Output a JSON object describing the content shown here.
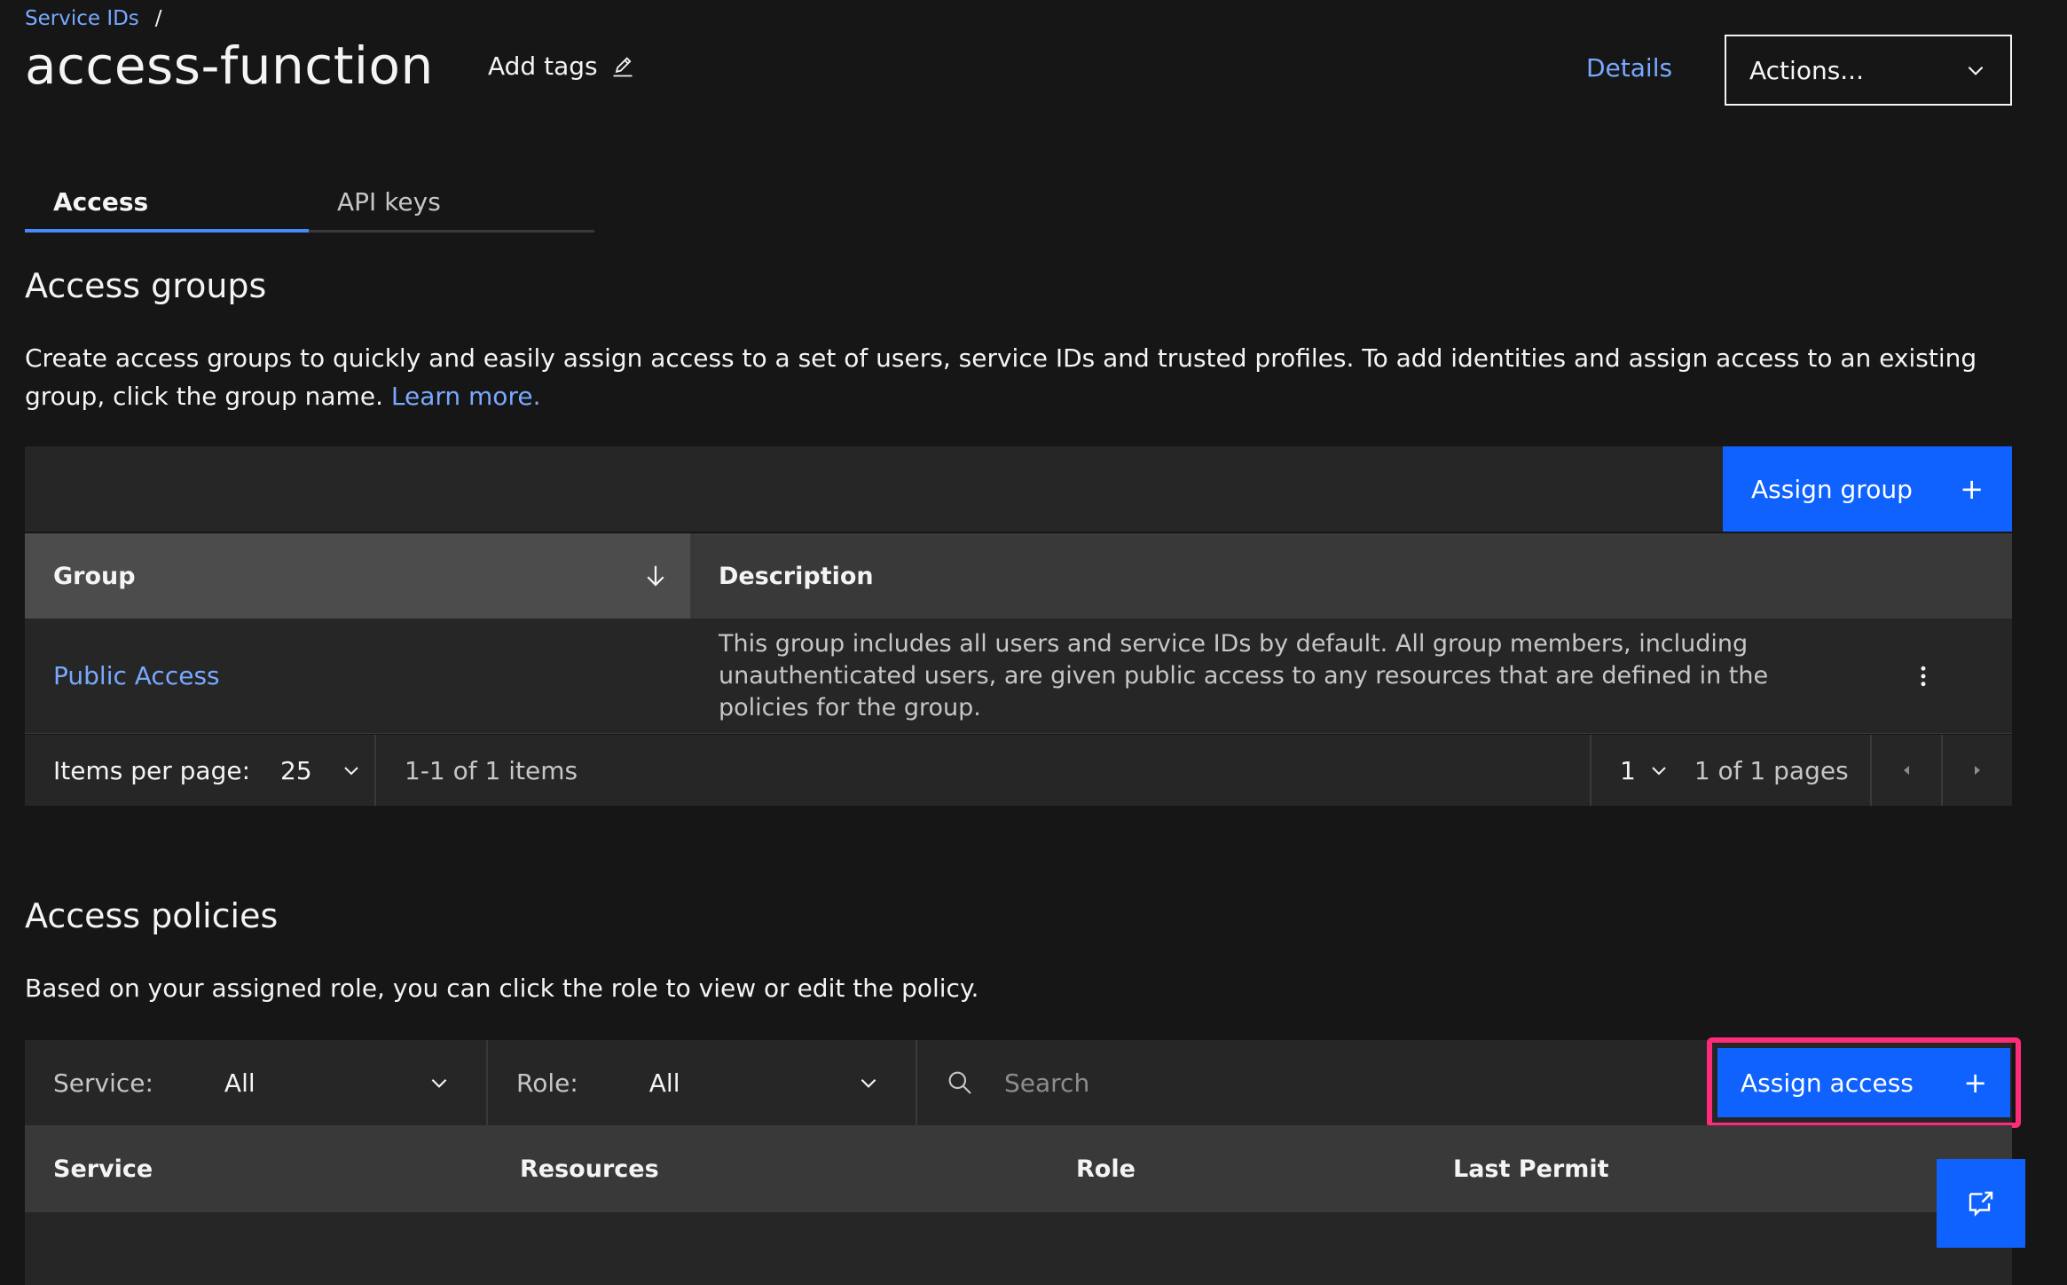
{
  "breadcrumb": {
    "items": [
      "Service IDs"
    ],
    "separator": "/"
  },
  "header": {
    "title": "access-function",
    "add_tags_label": "Add tags",
    "details_label": "Details",
    "actions_label": "Actions..."
  },
  "tabs": [
    {
      "label": "Access",
      "active": true
    },
    {
      "label": "API keys",
      "active": false
    }
  ],
  "access_groups": {
    "title": "Access groups",
    "description_text": "Create access groups to quickly and easily assign access to a set of users, service IDs and trusted profiles. To add identities and assign access to an existing group, click the group name.",
    "learn_more": "Learn more.",
    "assign_button": "Assign group",
    "columns": {
      "group": "Group",
      "description": "Description"
    },
    "rows": [
      {
        "group": "Public Access",
        "description": "This group includes all users and service IDs by default. All group members, including unauthenticated users, are given public access to any resources that are defined in the policies for the group."
      }
    ],
    "pagination": {
      "items_per_page_label": "Items per page:",
      "items_per_page_value": "25",
      "range_text": "1-1 of 1 items",
      "page_value": "1",
      "pages_text": "1 of 1 pages"
    }
  },
  "access_policies": {
    "title": "Access policies",
    "description_text": "Based on your assigned role, you can click the role to view or edit the policy.",
    "filters": {
      "service_label": "Service:",
      "service_value": "All",
      "role_label": "Role:",
      "role_value": "All",
      "search_placeholder": "Search"
    },
    "assign_button": "Assign access",
    "columns": {
      "service": "Service",
      "resources": "Resources",
      "role": "Role",
      "last_permit": "Last Permit"
    }
  },
  "colors": {
    "accent": "#0f62fe",
    "link": "#78a9ff",
    "highlight": "#ff2a7a",
    "background": "#161616"
  }
}
